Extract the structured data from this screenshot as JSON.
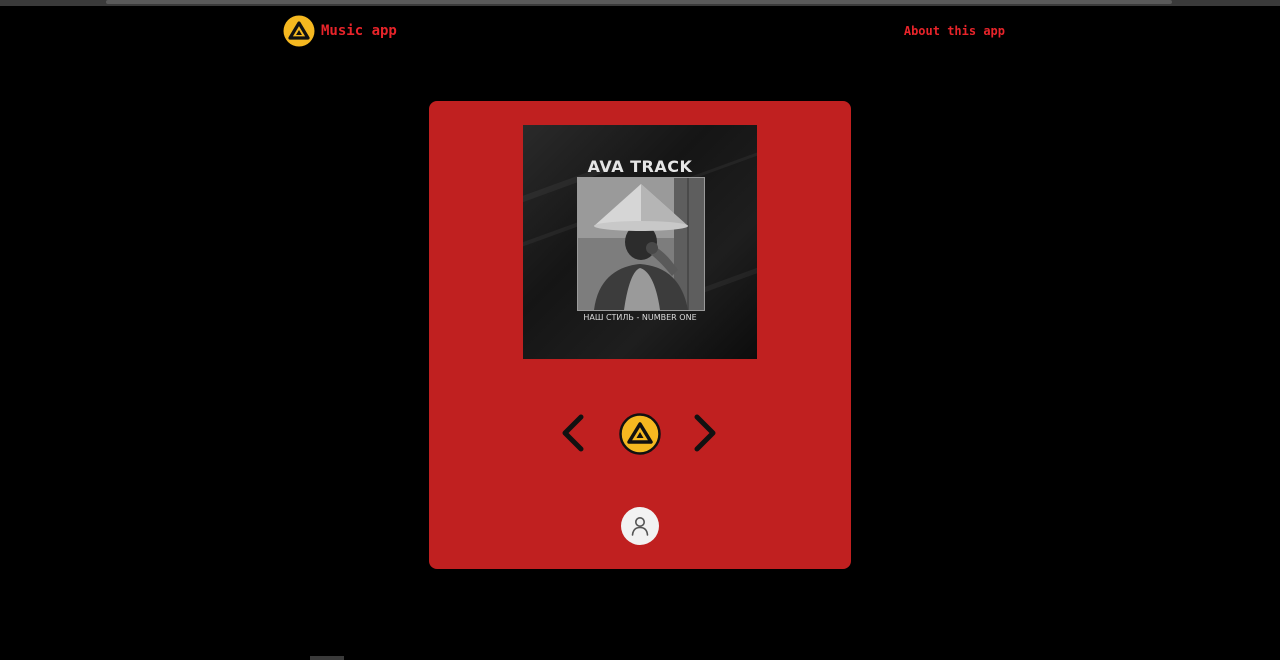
{
  "header": {
    "brand_label": "Music app",
    "about_label": "About this app"
  },
  "player": {
    "cover": {
      "title": "AVA TRACK",
      "subtitle": "НАШ СТИЛЬ - NUMBER ONE"
    },
    "controls": {
      "prev_icon": "chevron-left-icon",
      "play_icon": "aimp-logo-icon",
      "next_icon": "chevron-right-icon"
    },
    "user_icon": "user-icon"
  },
  "colors": {
    "accent_red": "#e8242a",
    "panel_red": "#c02020",
    "logo_yellow": "#f5b820",
    "background": "#000000"
  }
}
